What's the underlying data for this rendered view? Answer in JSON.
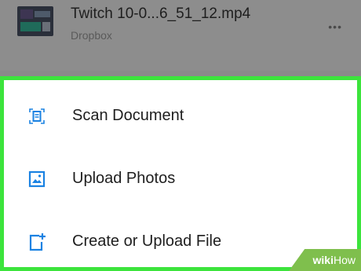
{
  "file": {
    "name": "Twitch 10-0...6_51_12.mp4",
    "source": "Dropbox",
    "more_label": "•••"
  },
  "actions": [
    {
      "label": "Scan Document",
      "icon": "scan-document-icon"
    },
    {
      "label": "Upload Photos",
      "icon": "upload-photos-icon"
    },
    {
      "label": "Create or Upload File",
      "icon": "create-file-icon"
    }
  ],
  "colors": {
    "accent": "#1a82e2",
    "highlight": "#3ce43c",
    "watermark": "#7fbf4d"
  },
  "watermark": {
    "wiki": "wiki",
    "how": "How"
  }
}
